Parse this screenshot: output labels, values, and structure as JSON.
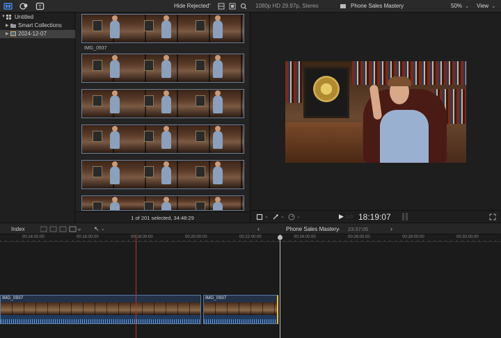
{
  "toolbar": {
    "filter_label": "Hide Rejected",
    "format_info": "1080p HD 29.97p, Stereo",
    "project_name": "Phone Sales Mastery",
    "zoom": "50%",
    "view_label": "View"
  },
  "sidebar": {
    "items": [
      {
        "label": "Untitled"
      },
      {
        "label": "Smart Collections"
      },
      {
        "label": "2024-12-07"
      }
    ]
  },
  "browser": {
    "clip_name": "IMG_0937",
    "status": "1 of 201 selected, 34:48:29"
  },
  "viewer": {
    "timecode": "18:19:07"
  },
  "timeline": {
    "index_label": "Index",
    "project_name": "Phone Sales Mastery",
    "duration": "23:37:05",
    "ruler_labels": [
      "00:14:00:00",
      "00:16:00:00",
      "00:18:00:00",
      "00:20:00:00",
      "00:22:00:00",
      "00:24:00:00",
      "00:26:00:00",
      "00:28:00:00",
      "00:30:00:00"
    ],
    "clips": [
      {
        "name": "IMG_0937"
      },
      {
        "name": "IMG_0937"
      }
    ]
  },
  "colors": {
    "accent": "#3a7bd5",
    "playhead_red": "#c03030",
    "clip_border": "#5a7aa0"
  }
}
